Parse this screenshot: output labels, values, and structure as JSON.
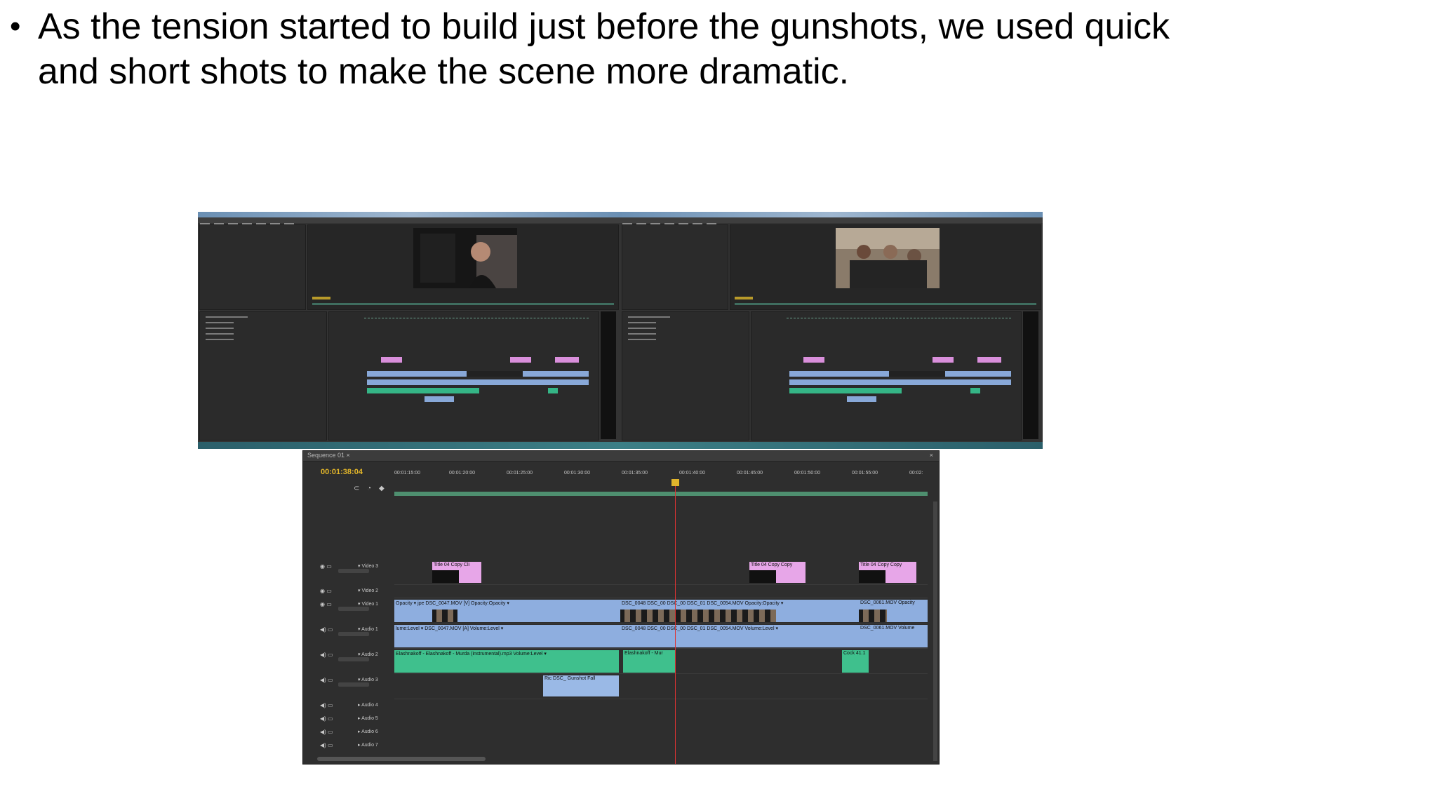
{
  "slide": {
    "bullet": "•",
    "text": "As the tension started to build just before the gunshots, we used quick and short shots to make the scene more dramatic."
  },
  "timeline": {
    "tab_label": "Sequence 01 ×",
    "close_label": "×",
    "timecode": "00:01:38:04",
    "ruler_ticks": [
      "00:01:15:00",
      "00:01:20:00",
      "00:01:25:00",
      "00:01:30:00",
      "00:01:35:00",
      "00:01:40:00",
      "00:01:45:00",
      "00:01:50:00",
      "00:01:55:00",
      "00:02:"
    ],
    "tools": "⊂ ◔ ◆",
    "tracks": [
      {
        "name": "▾ Video 3",
        "eye": "◉ ▭"
      },
      {
        "name": "▾ Video 2",
        "eye": "◉ ▭"
      },
      {
        "name": "▾ Video 1",
        "eye": "◉ ▭"
      },
      {
        "name": "▾ Audio 1",
        "eye": "◀) ▭"
      },
      {
        "name": "▾ Audio 2",
        "eye": "◀) ▭"
      },
      {
        "name": "▾ Audio 3",
        "eye": "◀) ▭"
      },
      {
        "name": "▸ Audio 4",
        "eye": "◀) ▭"
      },
      {
        "name": "▸ Audio 5",
        "eye": "◀) ▭"
      },
      {
        "name": "▸ Audio 6",
        "eye": "◀) ▭"
      },
      {
        "name": "▸ Audio 7",
        "eye": "◀) ▭"
      }
    ],
    "clips": {
      "title_1": "Title 04 Copy Cli",
      "title_2": "Title 04 Copy Copy",
      "title_3": "Title 04 Copy Copy",
      "video_a": "Opacity ▾ jpe DSC_0047.MOV [V] Opacity:Opacity ▾",
      "video_b": "DSC_0048 DSC_00 DSC_00 DSC_01 DSC_0054.MOV Opacity:Opacity ▾",
      "video_c": "DSC_0061.MOV Opacity",
      "audio_a": "lume:Level ▾ DSC_0047.MOV [A] Volume:Level ▾",
      "audio_b": "DSC_0048 DSC_00 DSC_00 DSC_01 DSC_0054.MOV Volume:Level ▾",
      "audio_c": "DSC_0061.MOV Volume",
      "music_a": "Elashnakoff - Elashnakoff - Murda (instrumental).mp3 Volume:Level ▾",
      "music_b": "Elashnakoff - Mur",
      "music_c": "Cock 41.1",
      "sfx": "Ric DSC_ Gunshot Fall"
    }
  },
  "screenshot_top": {
    "left_window": "Premiere editor window (left)",
    "right_window": "Premiere editor window (right)"
  },
  "colors": {
    "title_clip": "#e7a6e8",
    "video_clip": "#8eaedf",
    "music_clip": "#3fc08d",
    "timecode": "#e3b629",
    "playhead": "#dd3333"
  }
}
